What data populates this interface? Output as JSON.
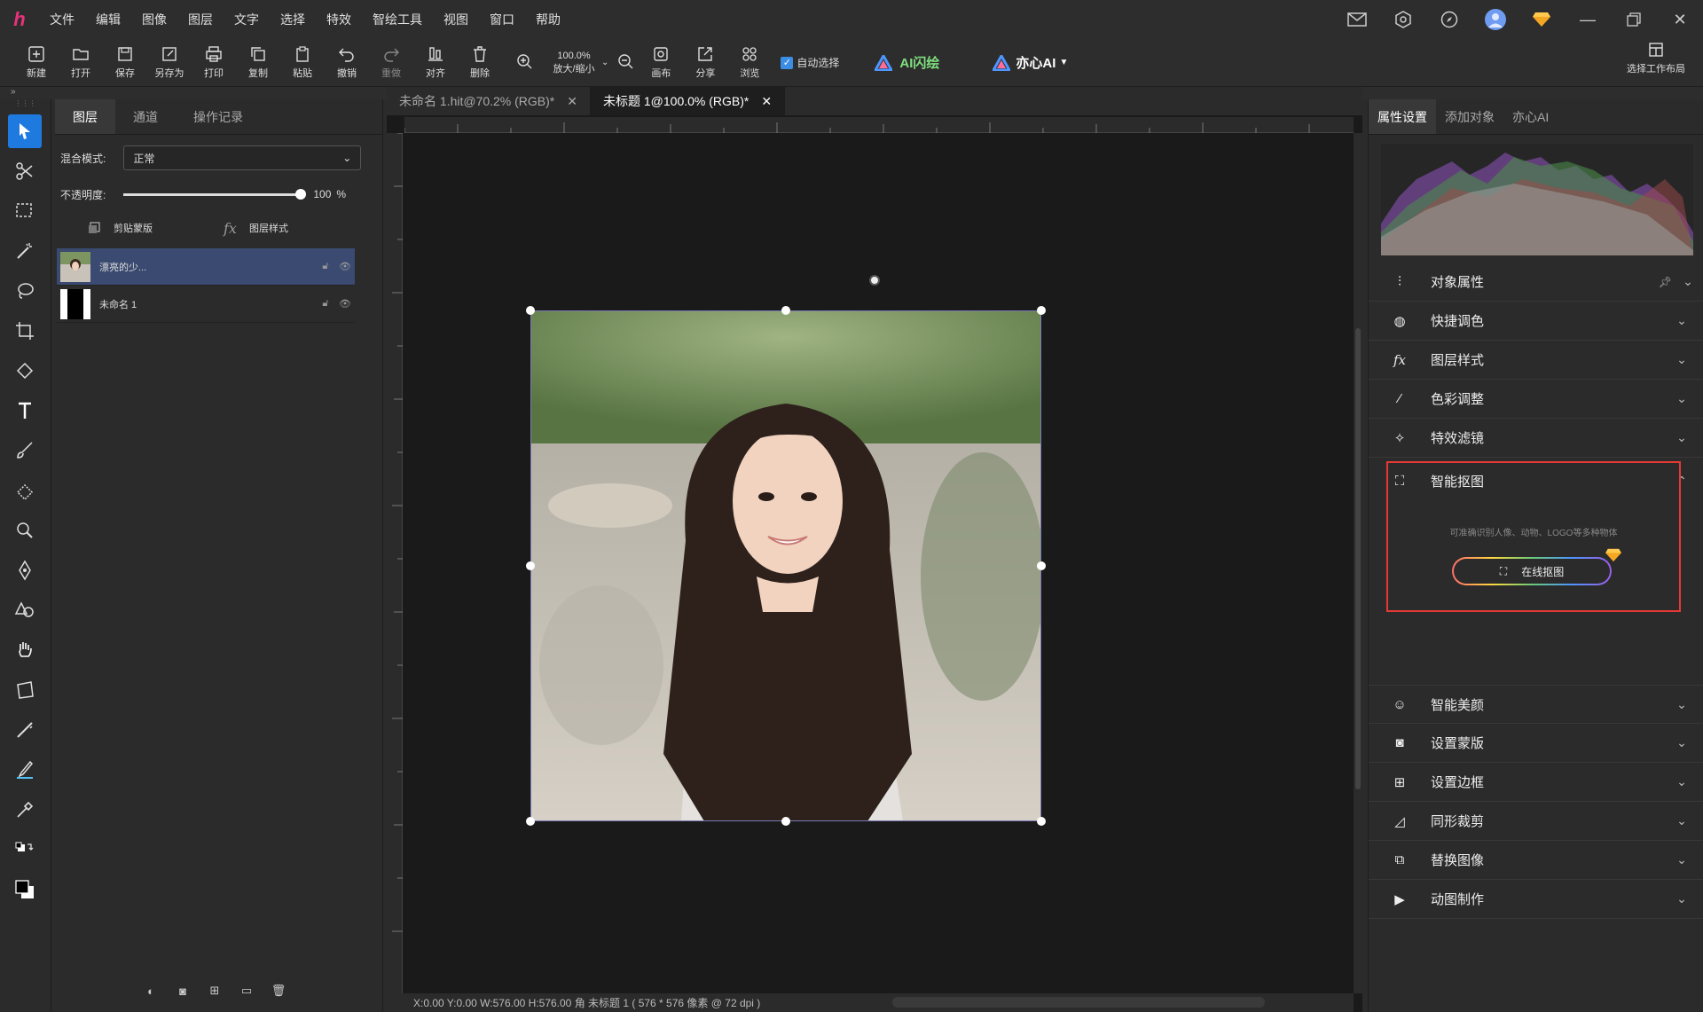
{
  "menubar": {
    "items": [
      "文件",
      "编辑",
      "图像",
      "图层",
      "文字",
      "选择",
      "特效",
      "智绘工具",
      "视图",
      "窗口",
      "帮助"
    ]
  },
  "toolbar": {
    "buttons": [
      "新建",
      "打开",
      "保存",
      "另存为",
      "打印",
      "复制",
      "粘贴",
      "撤销",
      "重做",
      "对齐",
      "删除"
    ],
    "zoom_value": "100.0%",
    "zoom_label": "放大/缩小",
    "after_zoom": [
      "画布",
      "分享",
      "浏览"
    ],
    "auto_select": "自动选择",
    "ai_flash": "AI闪绘",
    "yixin_ai": "亦心AI",
    "workspace": "选择工作布局"
  },
  "layer_panel": {
    "tabs": [
      "图层",
      "通道",
      "操作记录"
    ],
    "blend_label": "混合模式:",
    "blend_value": "正常",
    "opacity_label": "不透明度:",
    "opacity_value": "100",
    "opacity_unit": "%",
    "clip_mask": "剪贴蒙版",
    "layer_style": "图层样式",
    "layers": [
      {
        "name": "漂亮的少..."
      },
      {
        "name": "未命名 1"
      }
    ]
  },
  "doc_tabs": [
    {
      "label": "未命名 1.hit@70.2% (RGB)*"
    },
    {
      "label": "未标题 1@100.0% (RGB)*"
    }
  ],
  "status": "X:0.00 Y:0.00 W:576.00 H:576.00 角   未标题 1 ( 576 * 576 像素 @ 72 dpi )",
  "right_panel": {
    "tabs": [
      "属性设置",
      "添加对象",
      "亦心AI"
    ],
    "sections": [
      "对象属性",
      "快捷调色",
      "图层样式",
      "色彩调整",
      "特效滤镜",
      "智能抠图",
      "智能美颜",
      "设置蒙版",
      "设置边框",
      "同形裁剪",
      "替换图像",
      "动图制作"
    ],
    "smart_desc": "可准确识别人像、动物、LOGO等多种物体",
    "online_btn": "在线抠图"
  }
}
